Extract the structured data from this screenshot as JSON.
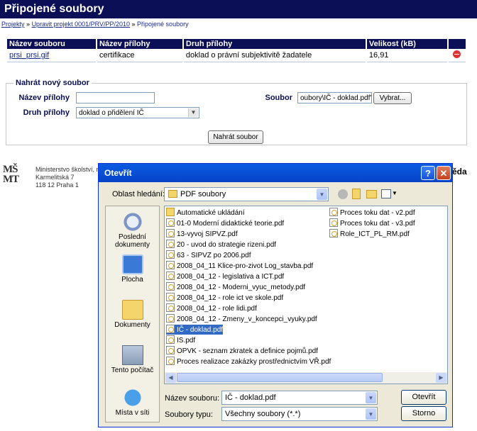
{
  "page": {
    "title": "Připojené soubory",
    "breadcrumb": [
      "Projekty",
      "Upravit projekt 0001/PRV/PP/2010",
      "Připojené soubory"
    ],
    "breadcrumb_sep": "»"
  },
  "files_table": {
    "headers": [
      "Název souboru",
      "Název přílohy",
      "Druh přílohy",
      "Velikost (kB)"
    ],
    "rows": [
      {
        "file": "prsi_prsi.gif",
        "name": "certifikace",
        "type": "doklad o právní subjektivitě žadatele",
        "size": "16,91"
      }
    ]
  },
  "upload": {
    "legend": "Nahrát nový soubor",
    "name_label": "Název přílohy",
    "name_value": "",
    "type_label": "Druh přílohy",
    "type_value": "doklad o přidělení IČ",
    "file_label": "Soubor",
    "file_value": "oubory\\IČ - doklad.pdf\"",
    "browse_label": "Vybrat...",
    "submit_label": "Nahrát soubor"
  },
  "footer": {
    "logo": "MŠMT",
    "lines": [
      "Ministerstvo školství, m",
      "Karmelitská 7",
      "118 12 Praha 1"
    ],
    "right_fragment": "ěda"
  },
  "dialog": {
    "title": "Otevřít",
    "look_in_label": "Oblast hledání:",
    "look_in_value": "PDF soubory",
    "places": [
      "Poslední dokumenty",
      "Plocha",
      "Dokumenty",
      "Tento počítač",
      "Místa v síti"
    ],
    "files_col1": [
      {
        "name": "Automatické ukládání",
        "kind": "folder"
      },
      {
        "name": "01-0 Moderní didaktické teorie.pdf",
        "kind": "pdf"
      },
      {
        "name": "13-vyvoj SIPVZ.pdf",
        "kind": "pdf"
      },
      {
        "name": "20 - uvod do strategie rizeni.pdf",
        "kind": "pdf"
      },
      {
        "name": "63 - SIPVZ po 2006.pdf",
        "kind": "pdf"
      },
      {
        "name": "2008_04_11 Klice-pro-zivot Log_stavba.pdf",
        "kind": "pdf"
      },
      {
        "name": "2008_04_12 - legislativa a ICT.pdf",
        "kind": "pdf"
      },
      {
        "name": "2008_04_12 - Moderni_vyuc_metody.pdf",
        "kind": "pdf"
      },
      {
        "name": "2008_04_12 - role ict ve skole.pdf",
        "kind": "pdf"
      },
      {
        "name": "2008_04_12 - role lidi.pdf",
        "kind": "pdf"
      },
      {
        "name": "2008_04_12 - Zmeny_v_koncepci_vyuky.pdf",
        "kind": "pdf"
      },
      {
        "name": "IČ - doklad.pdf",
        "kind": "pdf",
        "selected": true
      },
      {
        "name": "IS.pdf",
        "kind": "pdf"
      },
      {
        "name": "OPVK - seznam zkratek a definice pojmů.pdf",
        "kind": "pdf"
      },
      {
        "name": "Proces realizace zakázky prostřednictvím VŘ.pdf",
        "kind": "pdf"
      }
    ],
    "files_col2": [
      {
        "name": "Proces toku dat - v2.pdf",
        "kind": "pdf"
      },
      {
        "name": "Proces toku dat - v3.pdf",
        "kind": "pdf"
      },
      {
        "name": "Role_ICT_PL_RM.pdf",
        "kind": "pdf"
      }
    ],
    "filename_label": "Název souboru:",
    "filename_value": "IČ - doklad.pdf",
    "filetype_label": "Soubory typu:",
    "filetype_value": "Všechny soubory (*.*)",
    "open_label": "Otevřít",
    "cancel_label": "Storno",
    "help_label": "?",
    "close_label": "✕"
  },
  "colors": {
    "header_bg": "#0a0f56",
    "link": "#1a2a8c",
    "dialog_title": "#0a5be0",
    "selection": "#316ac5"
  }
}
